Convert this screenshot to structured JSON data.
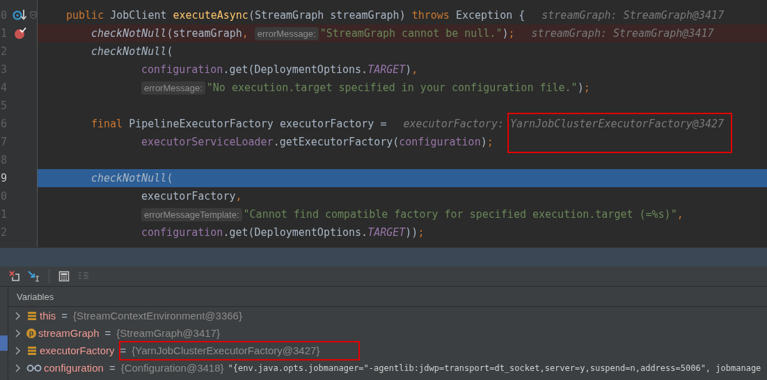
{
  "editor": {
    "lines": [
      {
        "number": "0",
        "kind": "method-breakpoint",
        "foldable": true,
        "parts": [
          {
            "kind": "code",
            "tokens": [
              {
                "kind": "keyword",
                "text": "public "
              },
              {
                "kind": "plain",
                "text": "JobClient "
              },
              {
                "kind": "method",
                "text": "executeAsync"
              },
              {
                "kind": "plain",
                "text": "(StreamGraph streamGraph) "
              },
              {
                "kind": "keyword",
                "text": "throws "
              },
              {
                "kind": "plain",
                "text": "Exception {"
              }
            ]
          },
          {
            "kind": "value",
            "text": "streamGraph: StreamGraph@3417",
            "annotated": false
          }
        ],
        "children": [
          {
            "number": "1",
            "kind": "breakpoint",
            "foldable": false,
            "parts": [
              {
                "kind": "code",
                "tokens": [
                  {
                    "kind": "static-call",
                    "text": "checkNotNull"
                  },
                  {
                    "kind": "plain",
                    "text": "(streamGraph"
                  },
                  {
                    "kind": "punctuation",
                    "text": ", "
                  }
                ]
              },
              {
                "kind": "hint",
                "text": "errorMessage:"
              },
              {
                "kind": "code",
                "tokens": [
                  {
                    "kind": "string",
                    "text": "\"StreamGraph cannot be null.\""
                  },
                  {
                    "kind": "plain",
                    "text": ")"
                  },
                  {
                    "kind": "punctuation",
                    "text": ";"
                  }
                ]
              },
              {
                "kind": "value",
                "text": "streamGraph: StreamGraph@3417",
                "annotated": false
              }
            ]
          },
          {
            "number": "2",
            "kind": "plain",
            "foldable": false,
            "parts": [
              {
                "kind": "code",
                "tokens": [
                  {
                    "kind": "static-call",
                    "text": "checkNotNull"
                  },
                  {
                    "kind": "plain",
                    "text": "("
                  }
                ]
              }
            ],
            "children": [
              {
                "number": "3",
                "kind": "plain",
                "foldable": false,
                "parts": [
                  {
                    "kind": "code",
                    "tokens": [
                      {
                        "kind": "field",
                        "text": "configuration"
                      },
                      {
                        "kind": "plain",
                        "text": ".get(DeploymentOptions."
                      },
                      {
                        "kind": "constant",
                        "text": "TARGET"
                      },
                      {
                        "kind": "plain",
                        "text": ")"
                      },
                      {
                        "kind": "punctuation",
                        "text": ","
                      }
                    ]
                  }
                ]
              },
              {
                "number": "4",
                "kind": "plain",
                "foldable": false,
                "parts": [
                  {
                    "kind": "hint",
                    "text": "errorMessage:"
                  },
                  {
                    "kind": "code",
                    "tokens": [
                      {
                        "kind": "string",
                        "text": "\"No execution.target specified in your configuration file.\""
                      },
                      {
                        "kind": "plain",
                        "text": ")"
                      },
                      {
                        "kind": "punctuation",
                        "text": ";"
                      }
                    ]
                  }
                ]
              }
            ]
          },
          {
            "number": "5",
            "kind": "plain",
            "foldable": false
          },
          {
            "number": "6",
            "kind": "plain",
            "foldable": false,
            "parts": [
              {
                "kind": "code",
                "tokens": [
                  {
                    "kind": "keyword",
                    "text": "final "
                  },
                  {
                    "kind": "plain",
                    "text": "PipelineExecutorFactory executorFactory ="
                  }
                ]
              },
              {
                "kind": "value",
                "text": "executorFactory:",
                "annotated": false
              },
              {
                "kind": "value",
                "text": "YarnJobClusterExecutorFactory@3427",
                "annotated": true
              }
            ],
            "children": [
              {
                "number": "7",
                "kind": "plain",
                "foldable": false,
                "parts": [
                  {
                    "kind": "code",
                    "tokens": [
                      {
                        "kind": "field",
                        "text": "executorServiceLoader"
                      },
                      {
                        "kind": "plain",
                        "text": ".getExecutorFactory("
                      },
                      {
                        "kind": "field",
                        "text": "configuration"
                      },
                      {
                        "kind": "plain",
                        "text": ")"
                      },
                      {
                        "kind": "punctuation",
                        "text": ";"
                      }
                    ]
                  }
                ]
              }
            ]
          },
          {
            "number": "8",
            "kind": "plain",
            "foldable": false
          },
          {
            "number": "9",
            "kind": "current",
            "foldable": false,
            "parts": [
              {
                "kind": "code",
                "tokens": [
                  {
                    "kind": "static-call",
                    "text": "checkNotNull"
                  },
                  {
                    "kind": "plain",
                    "text": "("
                  }
                ]
              }
            ],
            "children": [
              {
                "number": "0",
                "kind": "plain",
                "foldable": false,
                "parts": [
                  {
                    "kind": "code",
                    "tokens": [
                      {
                        "kind": "plain",
                        "text": "executorFactory"
                      },
                      {
                        "kind": "punctuation",
                        "text": ","
                      }
                    ]
                  }
                ]
              },
              {
                "number": "1",
                "kind": "plain",
                "foldable": false,
                "parts": [
                  {
                    "kind": "hint",
                    "text": "errorMessageTemplate:"
                  },
                  {
                    "kind": "code",
                    "tokens": [
                      {
                        "kind": "string",
                        "text": "\"Cannot find compatible factory for specified execution.target (=%s)\""
                      },
                      {
                        "kind": "punctuation",
                        "text": ","
                      }
                    ]
                  }
                ]
              },
              {
                "number": "2",
                "kind": "plain",
                "foldable": false,
                "parts": [
                  {
                    "kind": "code",
                    "tokens": [
                      {
                        "kind": "field",
                        "text": "configuration"
                      },
                      {
                        "kind": "plain",
                        "text": ".get(DeploymentOptions."
                      },
                      {
                        "kind": "constant",
                        "text": "TARGET"
                      },
                      {
                        "kind": "plain",
                        "text": "))"
                      },
                      {
                        "kind": "punctuation",
                        "text": ";"
                      }
                    ]
                  }
                ]
              }
            ]
          }
        ]
      }
    ]
  },
  "debugger": {
    "toolbar": [
      {
        "kind": "drop-frame",
        "disabled": false
      },
      {
        "kind": "run-to-cursor",
        "disabled": false
      },
      {
        "kind": "separator"
      },
      {
        "kind": "evaluate",
        "disabled": false
      },
      {
        "kind": "trace",
        "disabled": true
      }
    ],
    "variables_title": "Variables",
    "variables": [
      {
        "kind": "field",
        "name": "this",
        "separator": "=",
        "value": "{StreamContextEnvironment@3366}",
        "expanded": false,
        "annotated": false
      },
      {
        "kind": "parameter",
        "icon_letter": "p",
        "name": "streamGraph",
        "separator": "=",
        "value": "{StreamGraph@3417}",
        "expanded": false,
        "annotated": false
      },
      {
        "kind": "field",
        "name": "executorFactory",
        "separator": "=",
        "value": "{YarnJobClusterExecutorFactory@3427}",
        "expanded": false,
        "annotated": true
      },
      {
        "kind": "watch",
        "name": "configuration",
        "separator": "=",
        "value": "{Configuration@3418}",
        "string_value": "\"{env.java.opts.jobmanager=\"-agentlib:jdwp=transport=dt_socket,server=y,suspend=n,address=5006\", jobmanage",
        "expanded": false,
        "annotated": false
      }
    ]
  }
}
